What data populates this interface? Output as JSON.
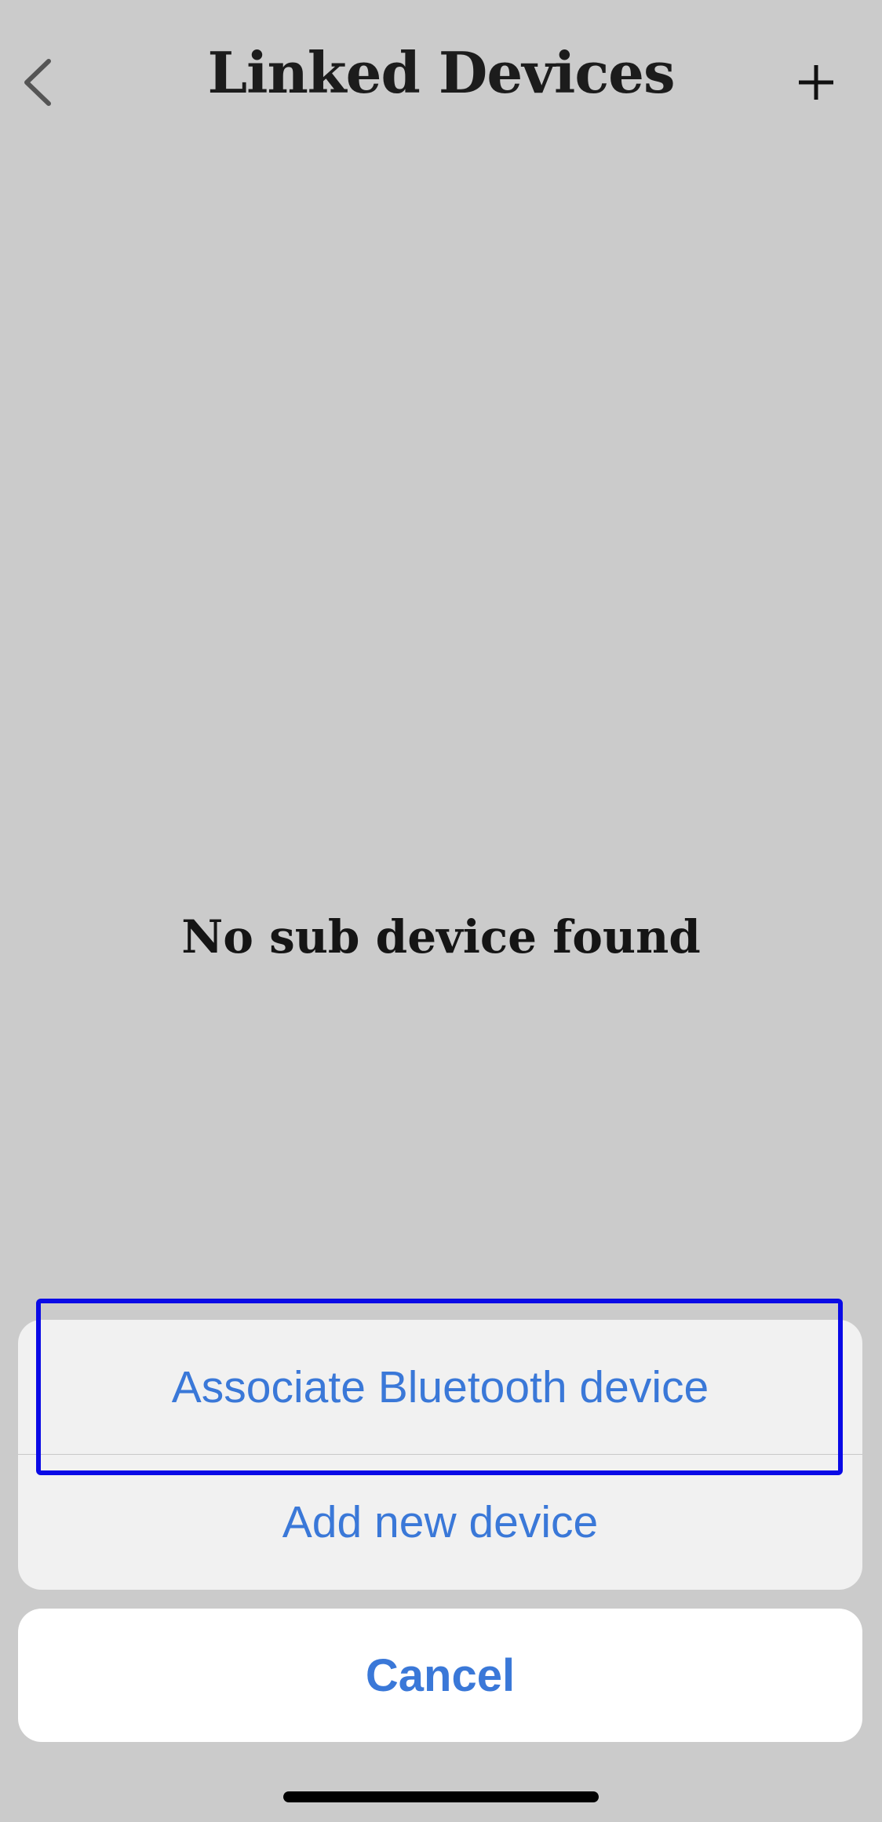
{
  "header": {
    "title": "Linked Devices",
    "back_icon": "chevron-left-icon",
    "add_icon": "plus-icon"
  },
  "main": {
    "empty_message": "No sub device found"
  },
  "action_sheet": {
    "options": [
      {
        "label": "Associate Bluetooth device",
        "highlighted": true
      },
      {
        "label": "Add new device",
        "highlighted": false
      }
    ],
    "cancel_label": "Cancel"
  },
  "colors": {
    "accent": "#3a78d8",
    "highlight_box": "#0a0ae6",
    "background": "#cbcbcb"
  }
}
